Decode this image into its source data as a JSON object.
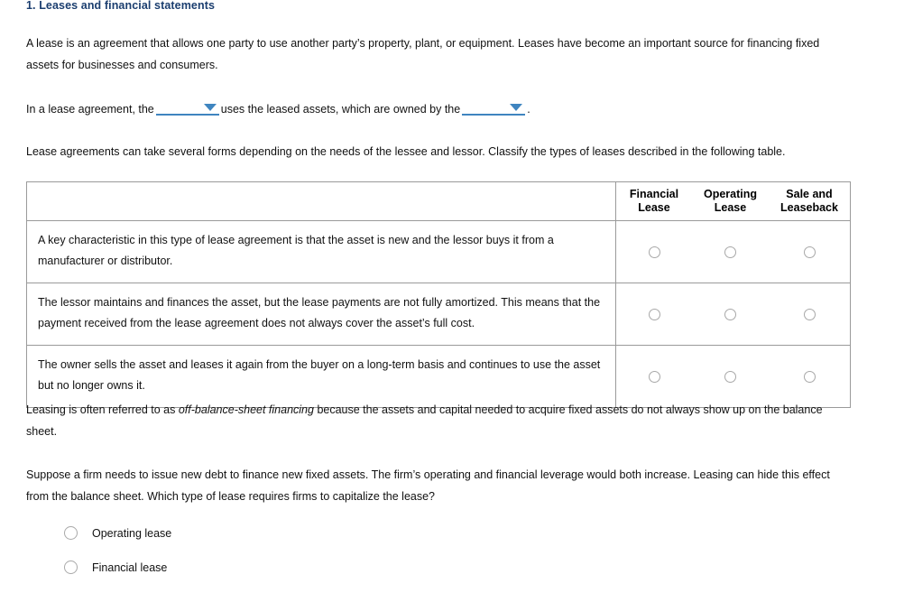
{
  "heading": "1. Leases and financial statements",
  "paragraphs": {
    "intro": "A lease is an agreement that allows one party to use another party’s property, plant, or equipment. Leases have become an important source for financing fixed assets for businesses and consumers.",
    "sentence_part1": "In a lease agreement, the",
    "sentence_part2": "uses the leased assets, which are owned by the",
    "sentence_part3": ".",
    "table_intro": "Lease agreements can take several forms depending on the needs of the lessee and lessor. Classify the types of leases described in the following table.",
    "offbalance_pre": "Leasing is often referred to as ",
    "offbalance_em": "off-balance-sheet financing",
    "offbalance_post": " because the assets and capital needed to acquire fixed assets do not always show up on the balance sheet.",
    "question": "Suppose a firm needs to issue new debt to finance new fixed assets. The firm’s operating and financial leverage would both increase. Leasing can hide this effect from the balance sheet. Which type of lease requires firms to capitalize the lease?"
  },
  "dropdowns": [
    {
      "name": "lessee-dropdown",
      "value": "",
      "caret": "chevron-down-icon"
    },
    {
      "name": "lessor-dropdown",
      "value": "",
      "caret": "chevron-down-icon"
    }
  ],
  "table": {
    "headers": {
      "description": "",
      "col1_line1": "Financial",
      "col1_line2": "Lease",
      "col2_line1": "Operating",
      "col2_line2": "Lease",
      "col3_line1": "Sale and",
      "col3_line2": "Leaseback"
    },
    "rows": [
      {
        "description": "A key characteristic in this type of lease agreement is that the asset is new and the lessor buys it from a manufacturer or distributor.",
        "selected": ""
      },
      {
        "description": "The lessor maintains and finances the asset, but the lease payments are not fully amortized. This means that the payment received from the lease agreement does not always cover the asset’s full cost.",
        "selected": ""
      },
      {
        "description": "The owner sells the asset and leases it again from the buyer on a long-term basis and continues to use the asset but no longer owns it.",
        "selected": ""
      }
    ]
  },
  "choices": [
    {
      "label": "Operating lease",
      "selected": false
    },
    {
      "label": "Financial lease",
      "selected": false
    }
  ],
  "colors": {
    "heading": "#1b3e6f",
    "dropdown_accent": "#3f85c0",
    "table_border": "#9a9a9a",
    "radio_border": "#a8a8a8",
    "text": "#111111"
  }
}
